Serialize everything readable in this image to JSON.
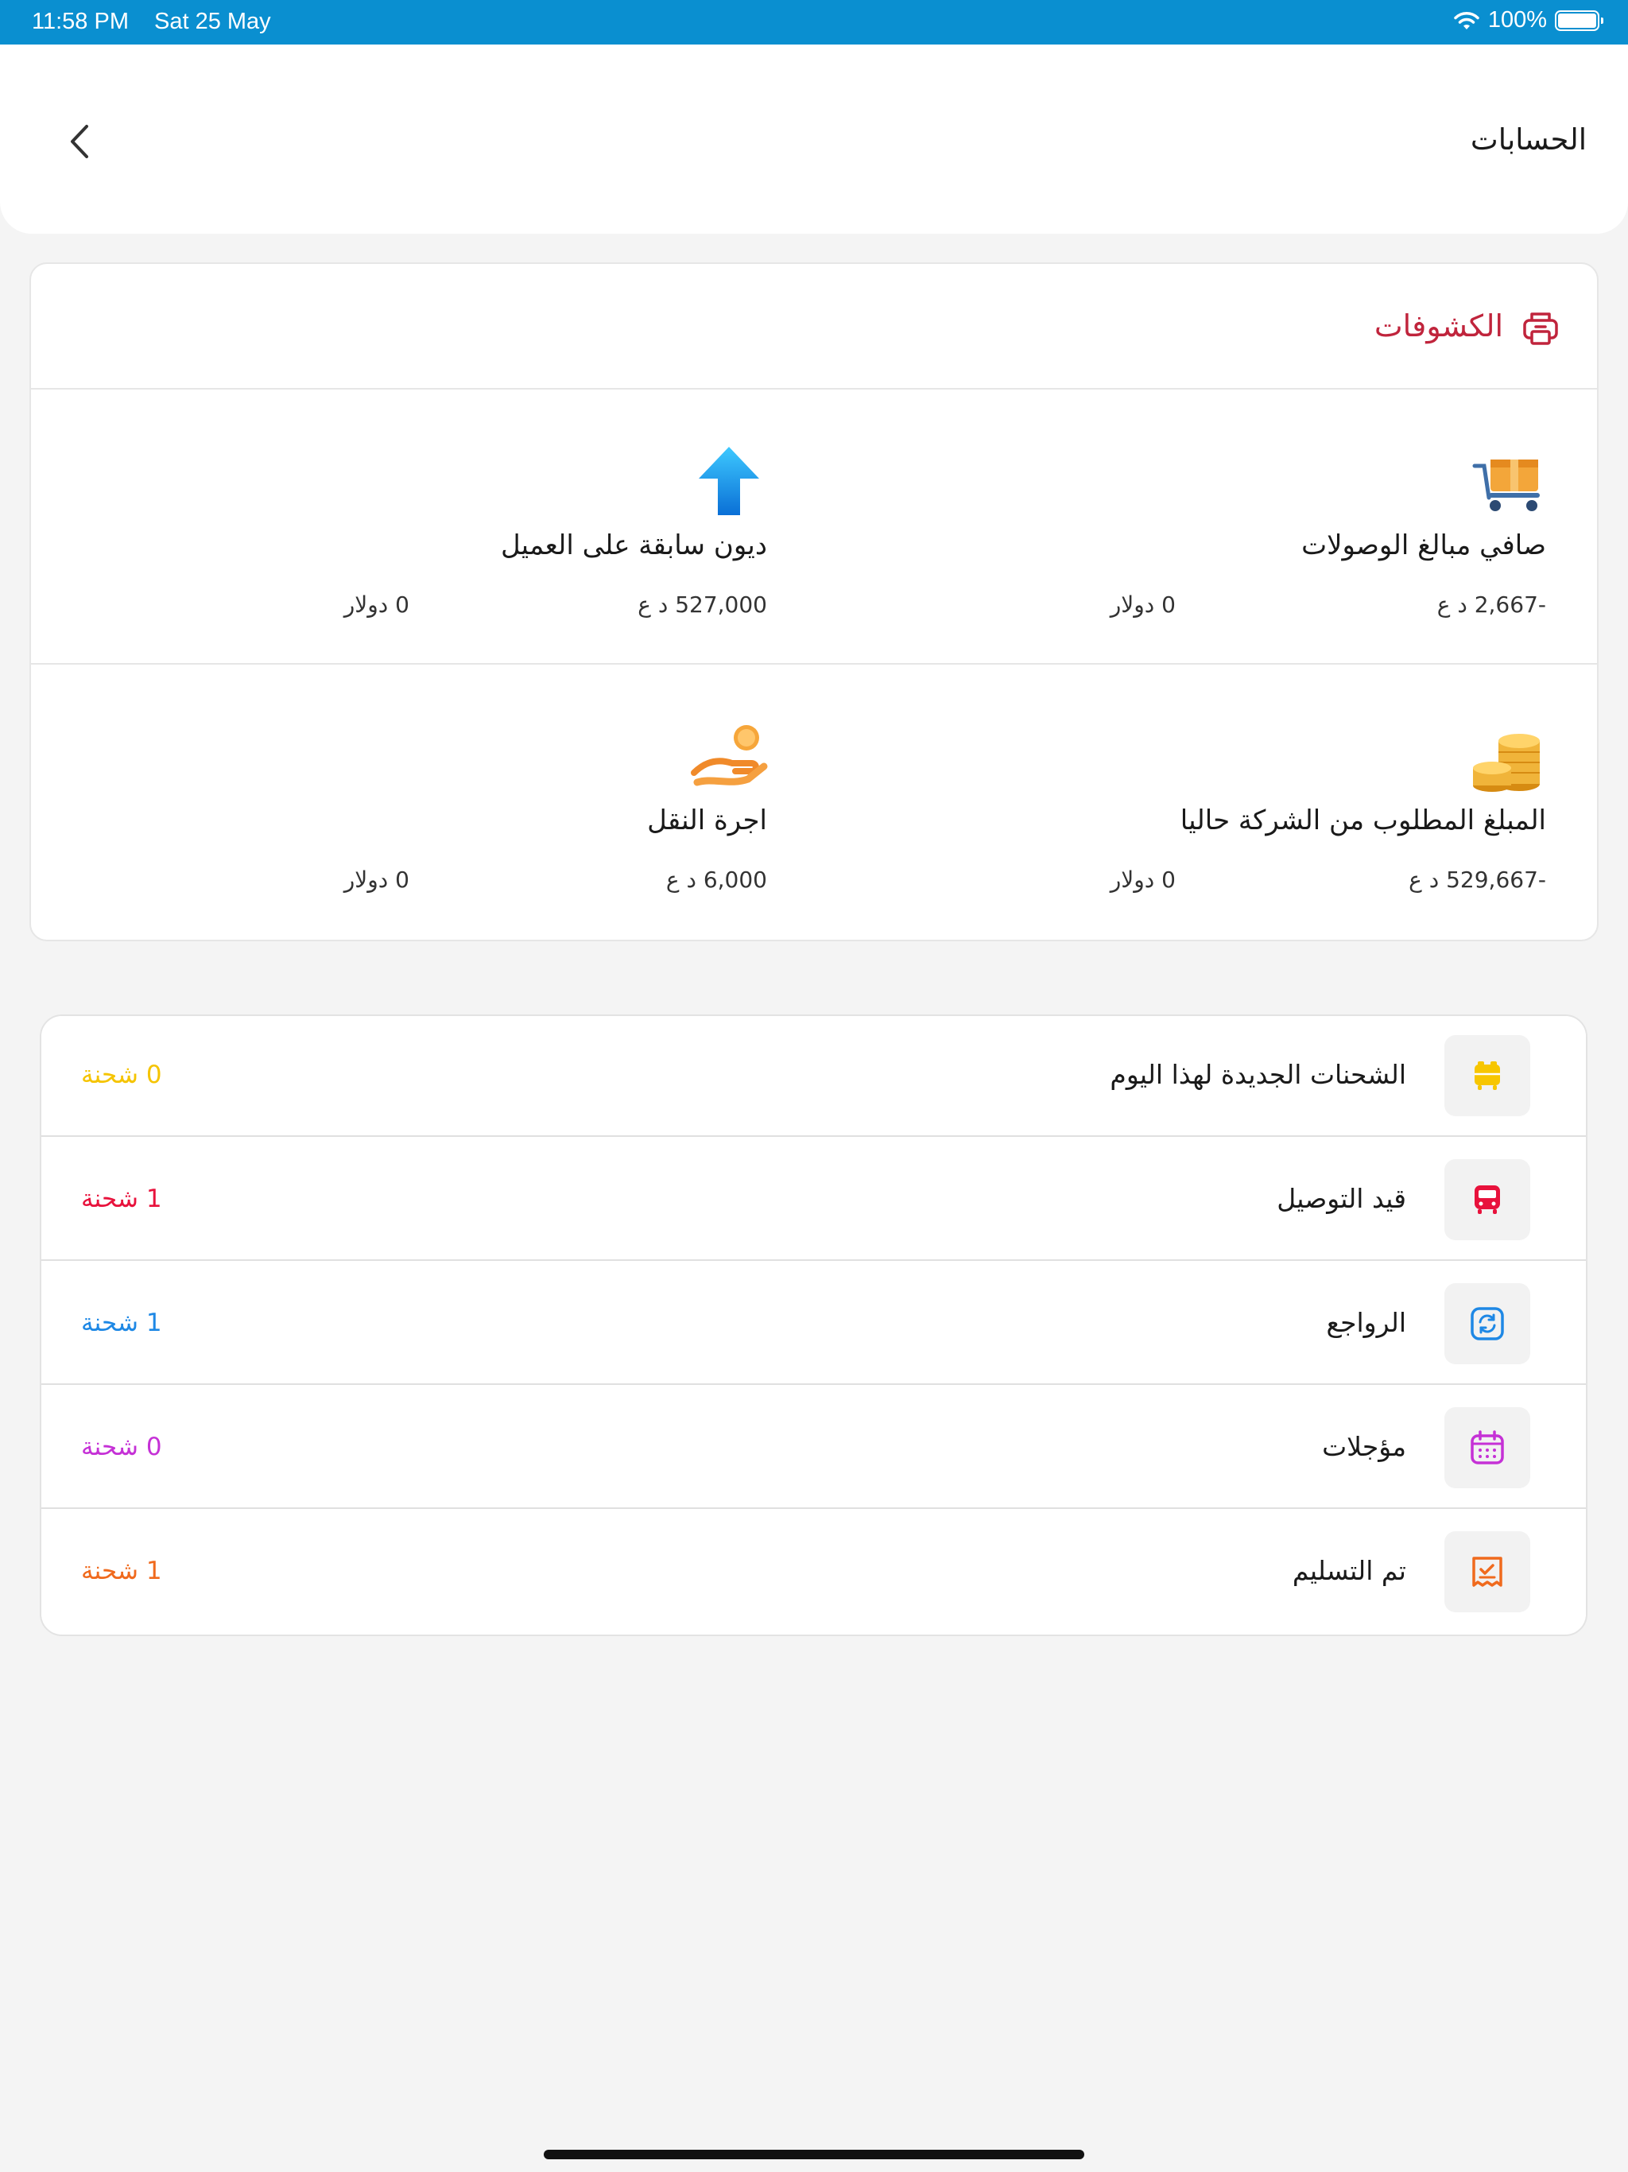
{
  "status_bar": {
    "time": "11:58 PM",
    "date": "Sat 25 May",
    "battery": "100%"
  },
  "header": {
    "title": "الحسابات"
  },
  "statements": {
    "title": "الكشوفات",
    "items": [
      {
        "label": "صافي مبالغ الوصولات",
        "iqd": "-2,667 د ع",
        "usd": "0 دولار",
        "icon": "cart-boxes-icon"
      },
      {
        "label": "ديون سابقة على العميل",
        "iqd": "527,000 د ع",
        "usd": "0 دولار",
        "icon": "arrow-up-icon"
      },
      {
        "label": "المبلغ المطلوب من الشركة حاليا",
        "iqd": "-529,667 د ع",
        "usd": "0 دولار",
        "icon": "coins-stack-icon"
      },
      {
        "label": "اجرة النقل",
        "iqd": "6,000 د ع",
        "usd": "0 دولار",
        "icon": "hand-coin-icon"
      }
    ]
  },
  "shipments": [
    {
      "label": "الشحنات الجديدة لهذا اليوم",
      "count": "0 شحنة",
      "color": "#f5c400",
      "icon": "new-shipments-icon"
    },
    {
      "label": "قيد التوصيل",
      "count": "1 شحنة",
      "color": "#e8123c",
      "icon": "delivery-bus-icon"
    },
    {
      "label": "الرواجع",
      "count": "1 شحنة",
      "color": "#1e88e5",
      "icon": "returns-sync-icon"
    },
    {
      "label": "مؤجلات",
      "count": "0 شحنة",
      "color": "#c531d6",
      "icon": "calendar-icon"
    },
    {
      "label": "تم التسليم",
      "count": "1 شحنة",
      "color": "#f06a1d",
      "icon": "delivered-receipt-icon"
    }
  ]
}
